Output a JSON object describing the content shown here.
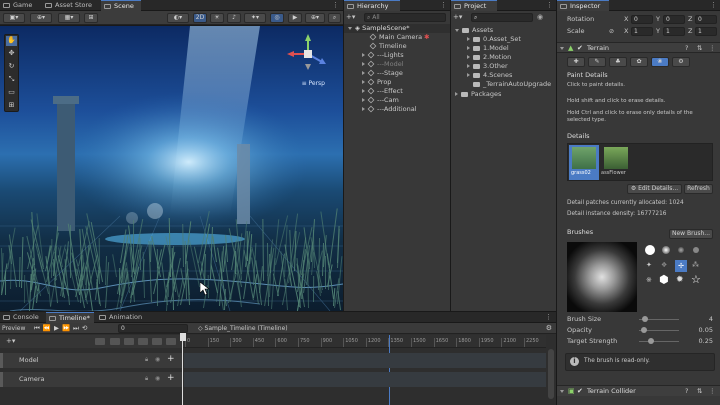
{
  "scene_tabs": [
    "Game",
    "Asset Store",
    "Scene"
  ],
  "scene_toolbar": {
    "mode_2d": "2D"
  },
  "gizmo": {
    "persp_label": "≡ Persp"
  },
  "hierarchy": {
    "tab": "Hierarchy",
    "search_placeholder": "All",
    "scene": "SampleScene*",
    "items": [
      "Main Camera",
      "Timeline",
      "---Lights",
      "---Model",
      "---Stage",
      "Prop",
      "---Effect",
      "---Cam",
      "---Additional"
    ]
  },
  "project": {
    "tab": "Project",
    "root": "Assets",
    "folders": [
      "0.Asset_Set",
      "1.Model",
      "2.Motion",
      "3.Other",
      "4.Scenes",
      "_TerrainAutoUpgrade"
    ],
    "packages": "Packages"
  },
  "inspector": {
    "tab": "Inspector",
    "rotation": {
      "label": "Rotation",
      "x": "0",
      "y": "0",
      "z": "0"
    },
    "scale": {
      "label": "Scale",
      "x": "1",
      "y": "1",
      "z": "1"
    },
    "component": "Terrain",
    "paint_details": "Paint Details",
    "help": [
      "Click to paint details.",
      "Hold shift and click to erase details.",
      "Hold Ctrl and click to erase only details of the selected type."
    ],
    "details_header": "Details",
    "detail_names": [
      "grass02",
      "assFlower"
    ],
    "edit_details": "Edit Details...",
    "refresh": "Refresh",
    "allocated": "Detail patches currently allocated: 1024",
    "density": "Detail instance density: 16777216",
    "brushes": "Brushes",
    "new_brush": "New Brush...",
    "brush_size": {
      "label": "Brush Size",
      "value": "4",
      "level": 0.08
    },
    "opacity": {
      "label": "Opacity",
      "value": "0.05",
      "level": 0.05
    },
    "target_strength": {
      "label": "Target Strength",
      "value": "0.25",
      "level": 0.25
    },
    "readonly": "The brush is read-only.",
    "collider": "Terrain Collider"
  },
  "bottom_tabs": [
    "Console",
    "Timeline*",
    "Animation"
  ],
  "timeline": {
    "preview": "Preview",
    "frame": "0",
    "asset": "Sample_Timeline (Timeline)",
    "ruler": [
      "0",
      "150",
      "300",
      "450",
      "600",
      "750",
      "900",
      "1050",
      "1200",
      "1350",
      "1500",
      "1650",
      "1800",
      "1950",
      "2100",
      "2250"
    ],
    "tracks": [
      "Model",
      "Camera"
    ]
  },
  "colors": {
    "accent": "#4b7bc4",
    "panel": "#383838",
    "toolbar": "#282828"
  }
}
